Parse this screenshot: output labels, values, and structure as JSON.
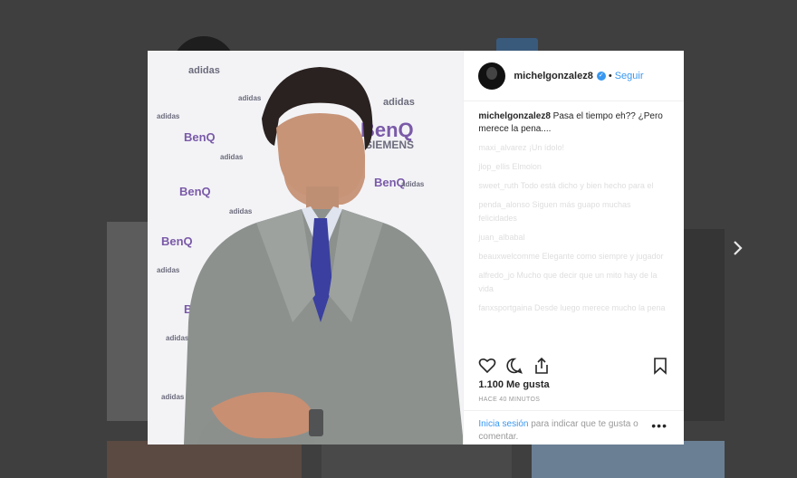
{
  "post": {
    "username": "michelgonzalez8",
    "follow_label": "Seguir",
    "dot": "•",
    "verified_mark": "✓",
    "caption_user": "michelgonzalez8",
    "caption_text": "Pasa el tiempo eh?? ¿Pero merece la pena....",
    "comments": [
      "maxi_alvarez ¡Un ídolo!",
      "jlop_ellis Elmolon",
      "sweet_ruth Todo está dicho y bien hecho para el",
      "penda_alonso Siguen más guapo muchas felicidades",
      "juan_albabal",
      "beauxwelcomme Elegante como siempre y jugador",
      "alfredo_jo Mucho que decir que un mito hay de la vida",
      "fanxsportgaina Desde luego merece mucho la pena"
    ],
    "likes": "1.100 Me gusta",
    "time": "HACE 40 MINUTOS",
    "login_link": "Inicia sesión",
    "login_text": "para indicar que te gusta o comentar.",
    "more": "•••"
  },
  "photo_brands": {
    "benq": "BenQ",
    "siemens": "SIEMENS",
    "adidas": "adidas"
  },
  "colors": {
    "link": "#3897f0",
    "text": "#262626",
    "muted": "#999999",
    "suit": "#8a8f8c",
    "tie": "#3a3fa0"
  },
  "icons": [
    "heart-icon",
    "comment-icon",
    "share-icon",
    "bookmark-icon",
    "next-arrow-icon",
    "verified-icon"
  ]
}
